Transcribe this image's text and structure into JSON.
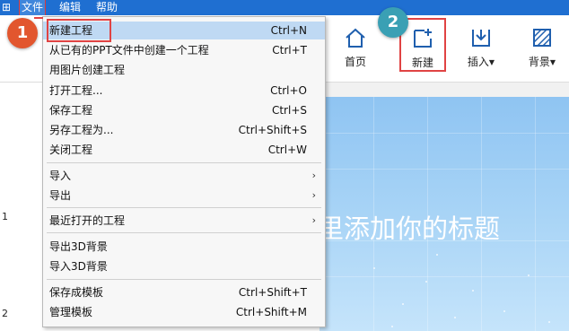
{
  "menubar": {
    "app_icon": "app-logo-icon",
    "items": [
      {
        "label": "文件"
      },
      {
        "label": "编辑"
      },
      {
        "label": "帮助"
      }
    ]
  },
  "ribbon": {
    "home_label": "首页",
    "new_label": "新建",
    "insert_label": "插入",
    "background_label": "背景"
  },
  "dropdown": {
    "items": [
      {
        "label": "新建工程",
        "shortcut": "Ctrl+N"
      },
      {
        "label": "从已有的PPT文件中创建一个工程",
        "shortcut": "Ctrl+T"
      },
      {
        "label": "用图片创建工程",
        "shortcut": ""
      },
      {
        "label": "打开工程...",
        "shortcut": "Ctrl+O"
      },
      {
        "label": "保存工程",
        "shortcut": "Ctrl+S"
      },
      {
        "label": "另存工程为...",
        "shortcut": "Ctrl+Shift+S"
      },
      {
        "label": "关闭工程",
        "shortcut": "Ctrl+W"
      },
      {
        "label": "导入",
        "shortcut": ""
      },
      {
        "label": "导出",
        "shortcut": ""
      },
      {
        "label": "最近打开的工程",
        "shortcut": ""
      },
      {
        "label": "导出3D背景",
        "shortcut": ""
      },
      {
        "label": "导入3D背景",
        "shortcut": ""
      },
      {
        "label": "保存成模板",
        "shortcut": "Ctrl+Shift+T"
      },
      {
        "label": "管理模板",
        "shortcut": "Ctrl+Shift+M"
      }
    ],
    "submenu_arrow": "›"
  },
  "badges": {
    "step1": "1",
    "step2": "2"
  },
  "canvas": {
    "title_text": "里添加你的标题"
  },
  "gutter": {
    "slide1": "1",
    "slide2": "2"
  },
  "colors": {
    "menubar": "#1f6fd1",
    "badge1": "#e2562e",
    "badge2": "#3aa0b4",
    "highlight": "#e04343"
  }
}
